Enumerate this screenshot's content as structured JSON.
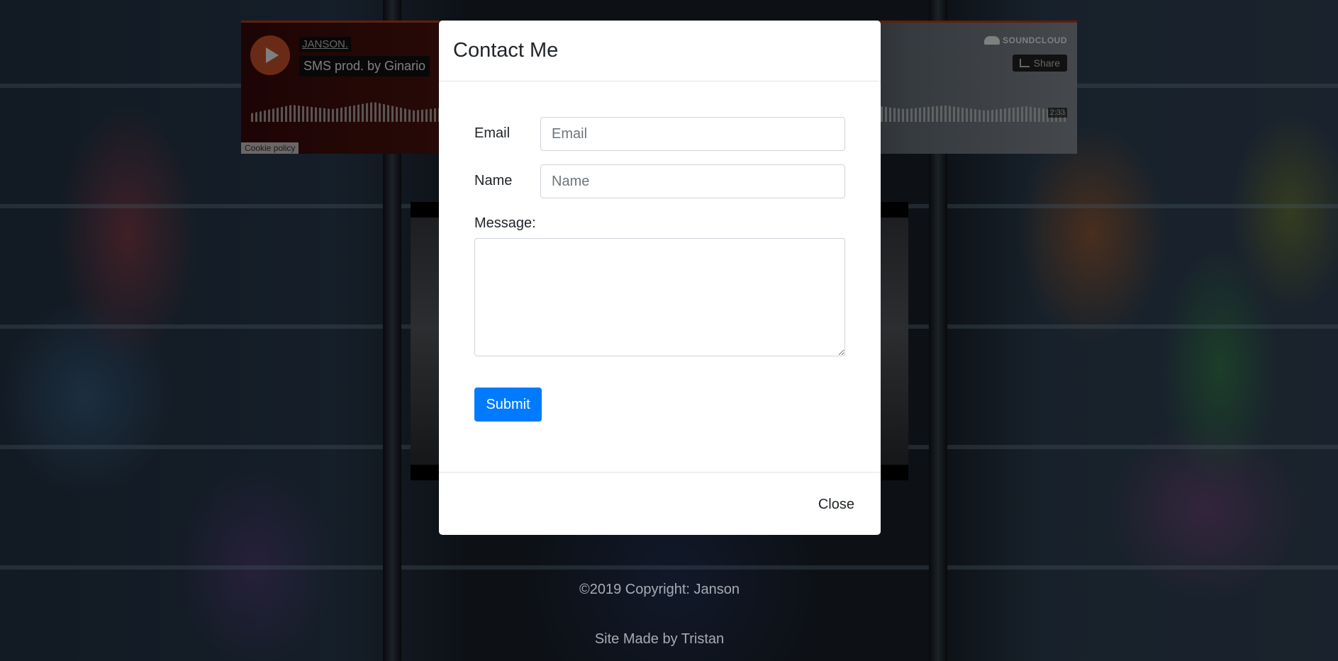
{
  "soundcloud": {
    "artist": "JANSON.",
    "track": "SMS prod. by Ginario",
    "brand": "SOUNDCLOUD",
    "share_label": "Share",
    "duration": "2:33",
    "cookie_label": "Cookie policy",
    "accent": "#ff5500"
  },
  "modal": {
    "title": "Contact Me",
    "email_label": "Email",
    "email_placeholder": "Email",
    "email_value": "",
    "name_label": "Name",
    "name_placeholder": "Name",
    "name_value": "",
    "message_label": "Message:",
    "message_value": "",
    "submit_label": "Submit",
    "close_label": "Close",
    "primary_color": "#007bff"
  },
  "footer": {
    "copyright": "©2019 Copyright: Janson",
    "credit": "Site Made by Tristan"
  }
}
